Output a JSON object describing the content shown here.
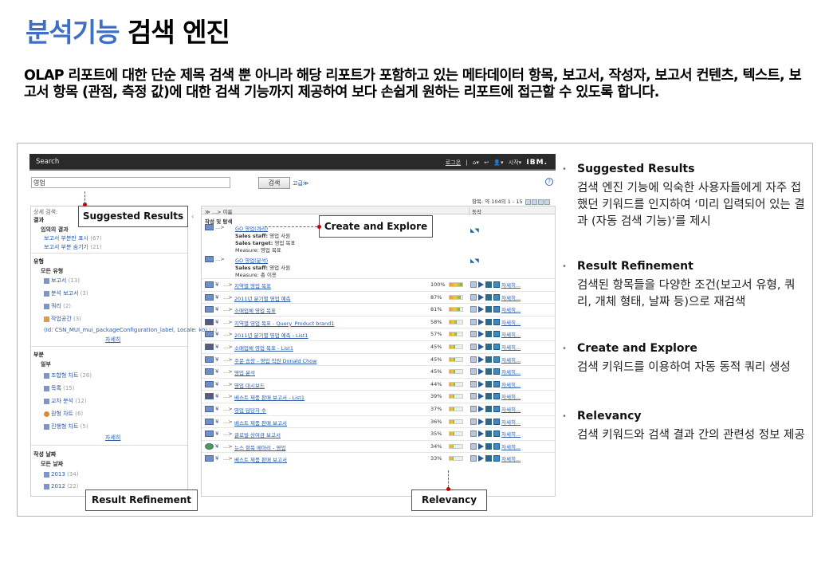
{
  "slide": {
    "title_accent": "분석기능",
    "title_rest": "검색 엔진",
    "intro": "OLAP 리포트에 대한 단순 제목 검색 뿐 아니라 해당 리포트가 포함하고 있는 메타데이터 항목, 보고서, 작성자, 보고서 컨텐츠, 텍스트, 보고서 항목 (관점, 측정 값)에 대한 검색 기능까지 제공하여 보다 손쉽게 원하는 리포트에 접근할 수 있도록 합니다."
  },
  "app": {
    "window_title": "Search",
    "nav": {
      "logout": "로그온",
      "sep": "|",
      "home": "⌂▾",
      "back": "↩",
      "user": "👤▾",
      "start": "시작▾",
      "brand": "IBM."
    },
    "search": {
      "value": "영업",
      "button": "검색",
      "advanced": "고급≫",
      "help": "?"
    },
    "pager": "항목: 약 104의 1 - 15",
    "left": {
      "header": "상세 검색:",
      "sections": {
        "results": "결과",
        "results_sub": "임의의 결과",
        "results_links": [
          {
            "label": "보고서 부분만 표시",
            "count": "(67)"
          },
          {
            "label": "보고서 부분 숨기기",
            "count": "(21)"
          }
        ],
        "type": "유형",
        "type_sub": "모든 유형",
        "type_items": [
          {
            "label": "보고서",
            "count": "(13)"
          },
          {
            "label": "분석 보고서",
            "count": "(3)"
          },
          {
            "label": "쿼리",
            "count": "(2)"
          },
          {
            "label": "작업공간",
            "count": "(3)"
          }
        ],
        "type_extra": "(Id: CSN_MUI_mui_packageConfiguration_label, Locale: ko)",
        "type_extra_count": "(1)",
        "more1": "자세히",
        "part": "부분",
        "part_sub": "일부",
        "part_items": [
          {
            "label": "조합형 차트",
            "count": "(26)"
          },
          {
            "label": "목록",
            "count": "(15)"
          },
          {
            "label": "교차 분석",
            "count": "(12)"
          },
          {
            "label": "원형 차트",
            "count": "(6)"
          },
          {
            "label": "진행형 차트",
            "count": "(5)"
          }
        ],
        "more2": "자세히",
        "date": "작성 날짜",
        "date_sub": "모든 날짜",
        "date_items": [
          {
            "label": "2013",
            "count": "(34)"
          },
          {
            "label": "2012",
            "count": "(22)"
          }
        ]
      }
    },
    "right": {
      "header": "≫ ...> 이름",
      "action_col": "동작",
      "section": "작성 및 탐색",
      "explore": [
        {
          "pre": "...>",
          "link": "GO 영업(쿼리)",
          "lines": [
            [
              "Sales staff:",
              "영업 사원"
            ],
            [
              "Sales target:",
              "영업 목표"
            ],
            [
              "Measure:",
              "영업 목표"
            ]
          ]
        },
        {
          "pre": "...>",
          "link": "GO 영업(분석)",
          "lines": [
            [
              "Sales staff:",
              "영업 사원"
            ],
            [
              "Measure:",
              "총 이용"
            ]
          ]
        }
      ],
      "rows": [
        {
          "name": "지역별 영업 목표",
          "pct": "100%",
          "fill": 100
        },
        {
          "name": "2011년 분기별 영업 예측",
          "pct": "87%",
          "fill": 87
        },
        {
          "name": "소매업체 영업 목표",
          "pct": "81%",
          "fill": 81
        },
        {
          "name": "지역별 영업 목표 - Query_Product brand1",
          "pct": "58%",
          "fill": 58
        },
        {
          "name": "2011년 분기별 영업 예측 - List1",
          "pct": "57%",
          "fill": 57
        },
        {
          "name": "소매업체 영업 목표 - List1",
          "pct": "45%",
          "fill": 45
        },
        {
          "name": "주문 송장 - 영업 직원 Donald Chow",
          "pct": "45%",
          "fill": 45
        },
        {
          "name": "영업 분석",
          "pct": "45%",
          "fill": 45
        },
        {
          "name": "영업 대시보드",
          "pct": "44%",
          "fill": 44
        },
        {
          "name": "베스트 제품 판매 보고서 - List1",
          "pct": "39%",
          "fill": 39
        },
        {
          "name": "영업 담당자 수",
          "pct": "37%",
          "fill": 37
        },
        {
          "name": "베스트 제품 판매 보고서",
          "pct": "36%",
          "fill": 36
        },
        {
          "name": "글로벌 상여금 보고서",
          "pct": "35%",
          "fill": 35
        },
        {
          "name": "뉴스 항목 메아리 - 영업",
          "pct": "34%",
          "fill": 34
        },
        {
          "name": "베스트 제품 판매 보고서",
          "pct": "33%",
          "fill": 33
        }
      ],
      "row_prefix": "...>",
      "row_detail": "자세히...",
      "tools": "◣◥"
    }
  },
  "callouts": {
    "suggested": "Suggested Results",
    "create": "Create and Explore",
    "refine": "Result Refinement",
    "relevancy": "Relevancy"
  },
  "bullets": [
    {
      "title": "Suggested Results",
      "body": "검색 엔진 기능에 익숙한 사용자들에게 자주 접했던 키워드를 인지하여 ‘미리 입력되어 있는 결과 (자동 검색 기능)’를 제시"
    },
    {
      "title": "Result Refinement",
      "body": "검색된 항목들을 다양한 조건(보고서 유형, 쿼리, 개체 형태, 날짜 등)으로 재검색"
    },
    {
      "title": "Create and Explore",
      "body": "검색 키워드를 이용하여 자동 동적 쿼리 생성"
    },
    {
      "title": "Relevancy",
      "body": "검색 키워드와 검색 결과 간의 관련성 정보 제공"
    }
  ],
  "bullet_marker": "•"
}
